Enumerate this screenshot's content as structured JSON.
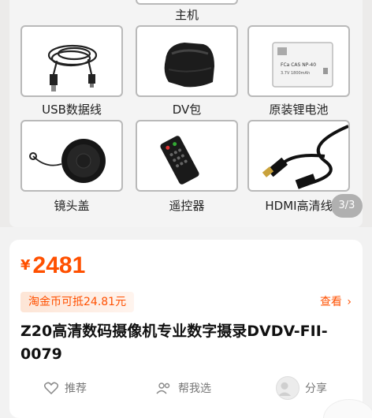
{
  "gallery": {
    "top_item": {
      "label": "主机",
      "icon": "camera-body-icon"
    },
    "items": [
      {
        "label": "USB数据线",
        "icon": "usb-cable-icon"
      },
      {
        "label": "DV包",
        "icon": "camera-bag-icon"
      },
      {
        "label": "原装锂电池",
        "icon": "lithium-battery-icon"
      },
      {
        "label": "镜头盖",
        "icon": "lens-cap-icon"
      },
      {
        "label": "遥控器",
        "icon": "remote-control-icon"
      },
      {
        "label": "HDMI高清线",
        "icon": "hdmi-cable-icon"
      }
    ],
    "battery_text": {
      "line1": "FCa  CAS  NP-40",
      "line2": "3.7V 1800mAh"
    },
    "pager": "3/3"
  },
  "product": {
    "currency": "¥",
    "price": "2481",
    "coin_tag": "淘金币可抵24.81元",
    "view_link": "查看",
    "title": "Z20高清数码摄像机专业数字摄录DVDV-FII-0079"
  },
  "actions": {
    "recommend": "推荐",
    "help_choose": "帮我选",
    "share": "分享"
  },
  "colors": {
    "accent": "#ff5000",
    "gallery_bg": "#ecebea",
    "card_bg": "#ffffff"
  }
}
